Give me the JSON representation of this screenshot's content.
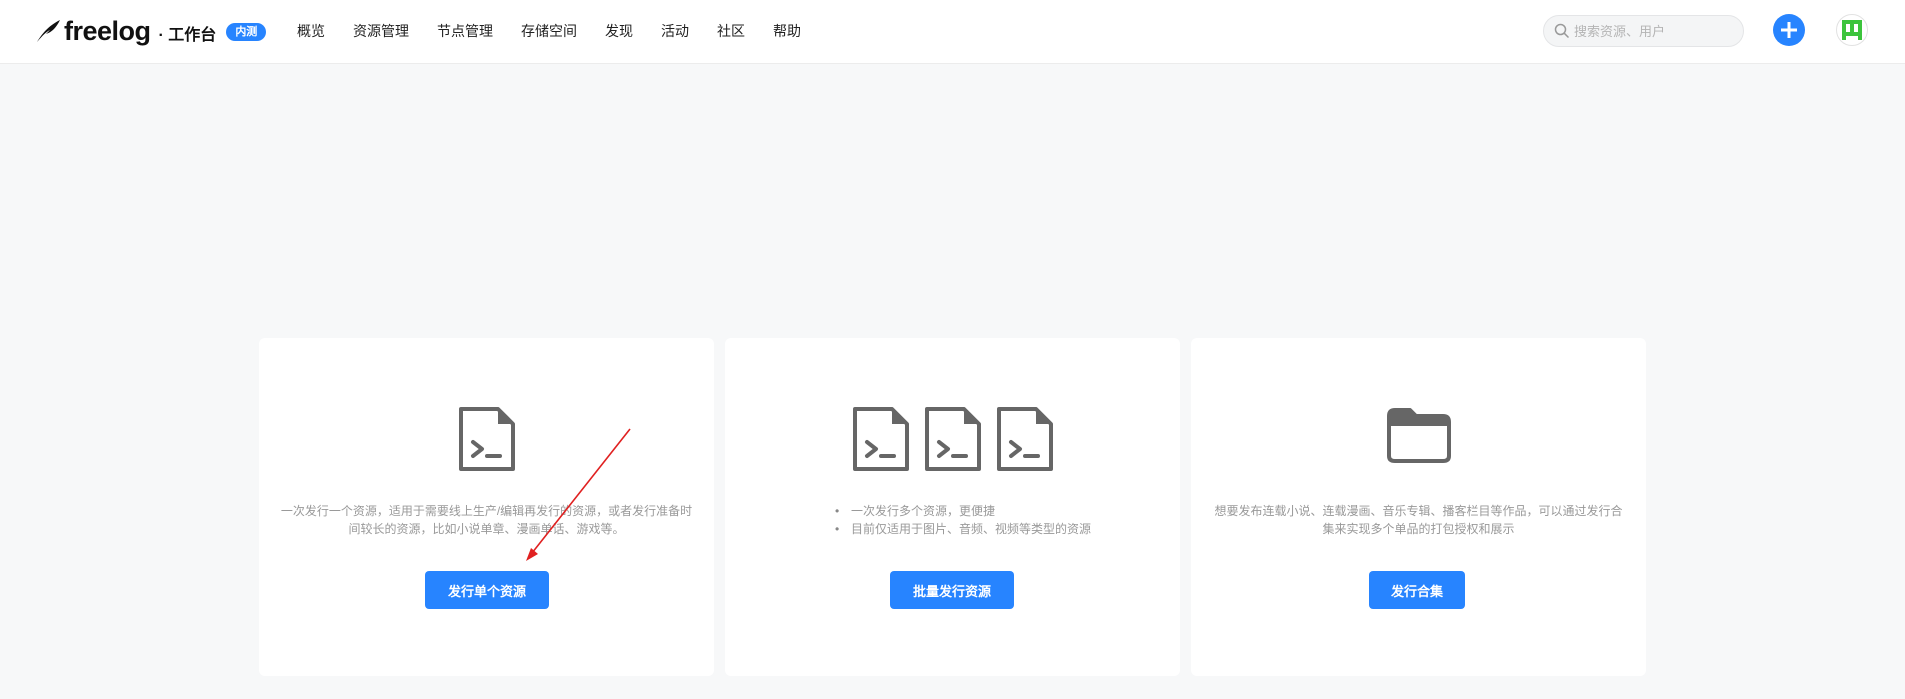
{
  "header": {
    "logo_text": "freelog",
    "workbench": "· 工作台",
    "badge": "内测",
    "nav": [
      "概览",
      "资源管理",
      "节点管理",
      "存储空间",
      "发现",
      "活动",
      "社区",
      "帮助"
    ],
    "search": {
      "placeholder": "搜索资源、用户",
      "value": ""
    },
    "icons": {
      "search": "search-icon",
      "add": "plus-icon",
      "avatar": "avatar-identicon"
    }
  },
  "cards": [
    {
      "icon": "file-terminal-icon",
      "description": "一次发行一个资源，适用于需要线上生产/编辑再发行的资源，或者发行准备时间较长的资源，比如小说单章、漫画单话、游戏等。",
      "button": "发行单个资源"
    },
    {
      "icon": "file-terminal-icon",
      "bullets": [
        "一次发行多个资源，更便捷",
        "目前仅适用于图片、音频、视频等类型的资源"
      ],
      "button": "批量发行资源"
    },
    {
      "icon": "folder-icon",
      "description": "想要发布连载小说、连载漫画、音乐专辑、播客栏目等作品，可以通过发行合集来实现多个单品的打包授权和展示",
      "button": "发行合集"
    }
  ],
  "colors": {
    "accent": "#2784ff",
    "annotation_arrow": "#e02020",
    "icon_gray": "#666666"
  }
}
